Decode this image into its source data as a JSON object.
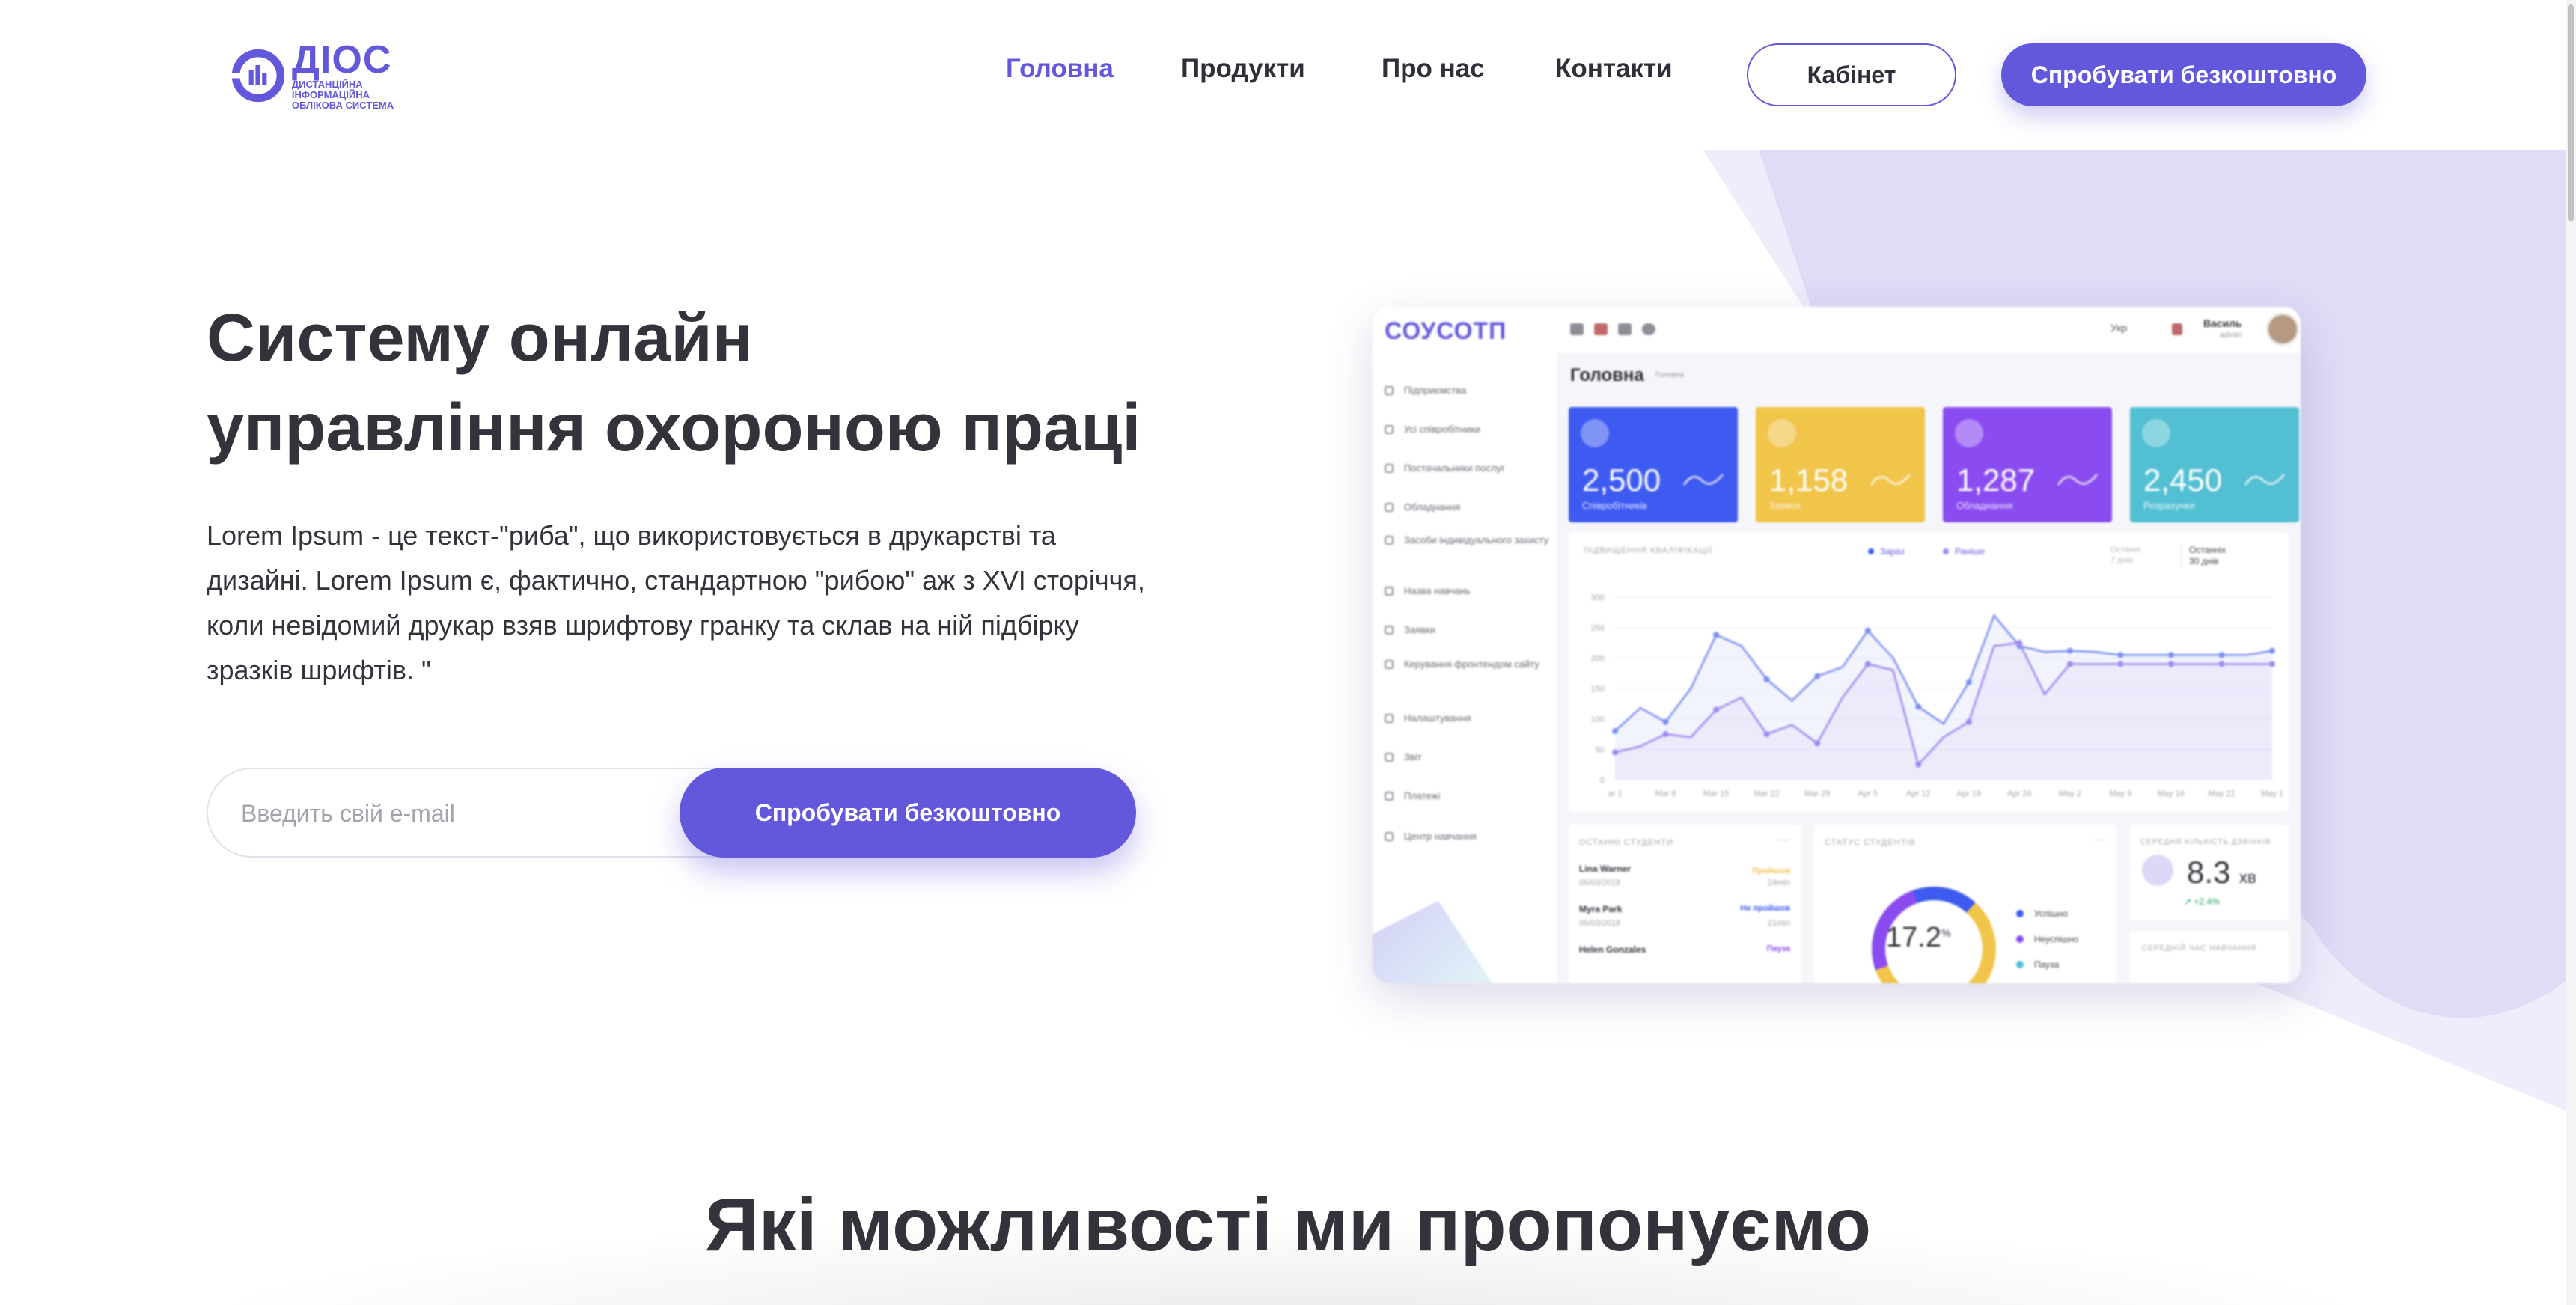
{
  "header": {
    "logo": {
      "name": "ДІОС",
      "subtitle_line1": "ДИСТАНЦІЙНА ІНФОРМАЦІЙНА",
      "subtitle_line2": "ОБЛІКОВА СИСТЕМА"
    },
    "nav": [
      {
        "label": "Головна",
        "active": true
      },
      {
        "label": "Продукти",
        "active": false
      },
      {
        "label": "Про нас",
        "active": false
      },
      {
        "label": "Контакти",
        "active": false
      }
    ],
    "cabinet_label": "Кабінет",
    "try_label": "Спробувати безкоштовно"
  },
  "hero": {
    "title_line1": "Систему онлайн",
    "title_line2": "управління охороною праці",
    "text": "Lorem Ipsum - це текст-\"риба\", що використовується в друкарстві та дизайні. Lorem Ipsum є, фактично, стандартною \"рибою\" аж з XVI сторіччя, коли невідомий друкар взяв шрифтову гранку та склав на ній підбірку зразків шрифтів. \"",
    "email_placeholder": "Введить свій e-mail",
    "try_label": "Спробувати безкоштовно"
  },
  "dashboard": {
    "brand": "СОУСОТП",
    "sidebar": [
      "Підприємства",
      "Усі співробітники",
      "Постачальники послуг",
      "Обладнання",
      "Засоби індивідуального захисту",
      "Назва навчань",
      "Заявки",
      "Керування фронтендом сайту",
      "Налаштування",
      "Звіт",
      "Платежі",
      "Центр навчання"
    ],
    "topbar": {
      "lang": "Укр",
      "user": "Василь",
      "role": "admin"
    },
    "page_title": "Головна",
    "breadcrumb": "Головна",
    "stats": [
      {
        "value": "2,500",
        "label": "Співробітників",
        "color": "#3d5af1"
      },
      {
        "value": "1,158",
        "label": "Заявок",
        "color": "#f1c44a"
      },
      {
        "value": "1,287",
        "label": "Обладнання",
        "color": "#8a4cf0"
      },
      {
        "value": "2,450",
        "label": "Розрахунки",
        "color": "#52bfd3"
      }
    ],
    "chart": {
      "title": "ПІДВИЩЕННЯ КВАЛІФІКАЦІЇ",
      "legend_now": "Зараз",
      "legend_before": "Раніше",
      "range_a_line1": "Останні",
      "range_a_line2": "7 днів",
      "range_b_line1": "Останніх",
      "range_b_line2": "30 днів"
    },
    "students": {
      "title": "ОСТАННІ СТУДЕНТИ",
      "rows": [
        {
          "name": "Lina Warner",
          "date": "06/03/2018",
          "status": "Пройшов",
          "time": "24min",
          "status_color": "#f1c44a"
        },
        {
          "name": "Myra Park",
          "date": "06/03/2018",
          "status": "Не пройшов",
          "time": "21min",
          "status_color": "#3d5af1"
        },
        {
          "name": "Helen Gonzales",
          "date": "",
          "status": "Пауза",
          "time": "",
          "status_color": "#8a4cf0"
        }
      ]
    },
    "status_card": {
      "title": "СТАТУС СТУДЕНТІВ",
      "value": "17.2",
      "value_unit": "%",
      "legend": [
        {
          "label": "Успішно",
          "color": "#3d5af1"
        },
        {
          "label": "Неуспішно",
          "color": "#8a4cf0"
        },
        {
          "label": "Пауза",
          "color": "#52bfd3"
        }
      ]
    },
    "avg_card": {
      "title": "СЕРЕДНЯ КІЛЬКІСТЬ ДЗВІНКІВ",
      "value": "8.3",
      "unit": "хв",
      "delta": "↗ +2.4%",
      "title2": "СЕРЕДНІЙ ЧАС НАВЧАННЯ"
    }
  },
  "chart_data": {
    "type": "line",
    "title": "ПІДВИЩЕННЯ КВАЛІФІКАЦІЇ",
    "categories": [
      "ar 1",
      "Mar 8",
      "Mar 15",
      "Mar 22",
      "Mar 29",
      "Apr 5",
      "Apr 12",
      "Apr 19",
      "Apr 26",
      "May 2",
      "May 9",
      "May 16",
      "May 22",
      "May 1"
    ],
    "ylim": [
      0,
      300
    ],
    "yticks": [
      0,
      50,
      100,
      150,
      200,
      250,
      300
    ],
    "series": [
      {
        "name": "Зараз",
        "color": "#7c8ff0",
        "x": [
          0,
          0.5,
          1,
          1.5,
          2,
          2.5,
          3,
          3.5,
          4,
          4.5,
          5,
          5.5,
          6,
          6.5,
          7,
          7.5,
          8,
          8.5,
          9,
          9.5,
          10,
          10.5,
          11,
          11.5,
          12,
          12.5,
          13
        ],
        "values": [
          80,
          118,
          95,
          150,
          238,
          220,
          165,
          130,
          170,
          185,
          245,
          200,
          120,
          92,
          160,
          270,
          220,
          210,
          212,
          210,
          205,
          205,
          205,
          205,
          205,
          205,
          212
        ]
      },
      {
        "name": "Раніше",
        "color": "#a189f0",
        "x": [
          0,
          0.5,
          1,
          1.5,
          2,
          2.5,
          3,
          3.5,
          4,
          4.5,
          5,
          5.5,
          6,
          6.5,
          7,
          7.5,
          8,
          8.5,
          9,
          9.5,
          10,
          10.5,
          11,
          11.5,
          12,
          12.5,
          13
        ],
        "values": [
          45,
          55,
          75,
          70,
          115,
          135,
          75,
          90,
          60,
          135,
          190,
          180,
          25,
          70,
          95,
          220,
          225,
          140,
          190,
          190,
          190,
          190,
          190,
          190,
          190,
          190,
          190
        ]
      }
    ]
  },
  "section": {
    "title": "Які можливості ми пропонуємо"
  }
}
